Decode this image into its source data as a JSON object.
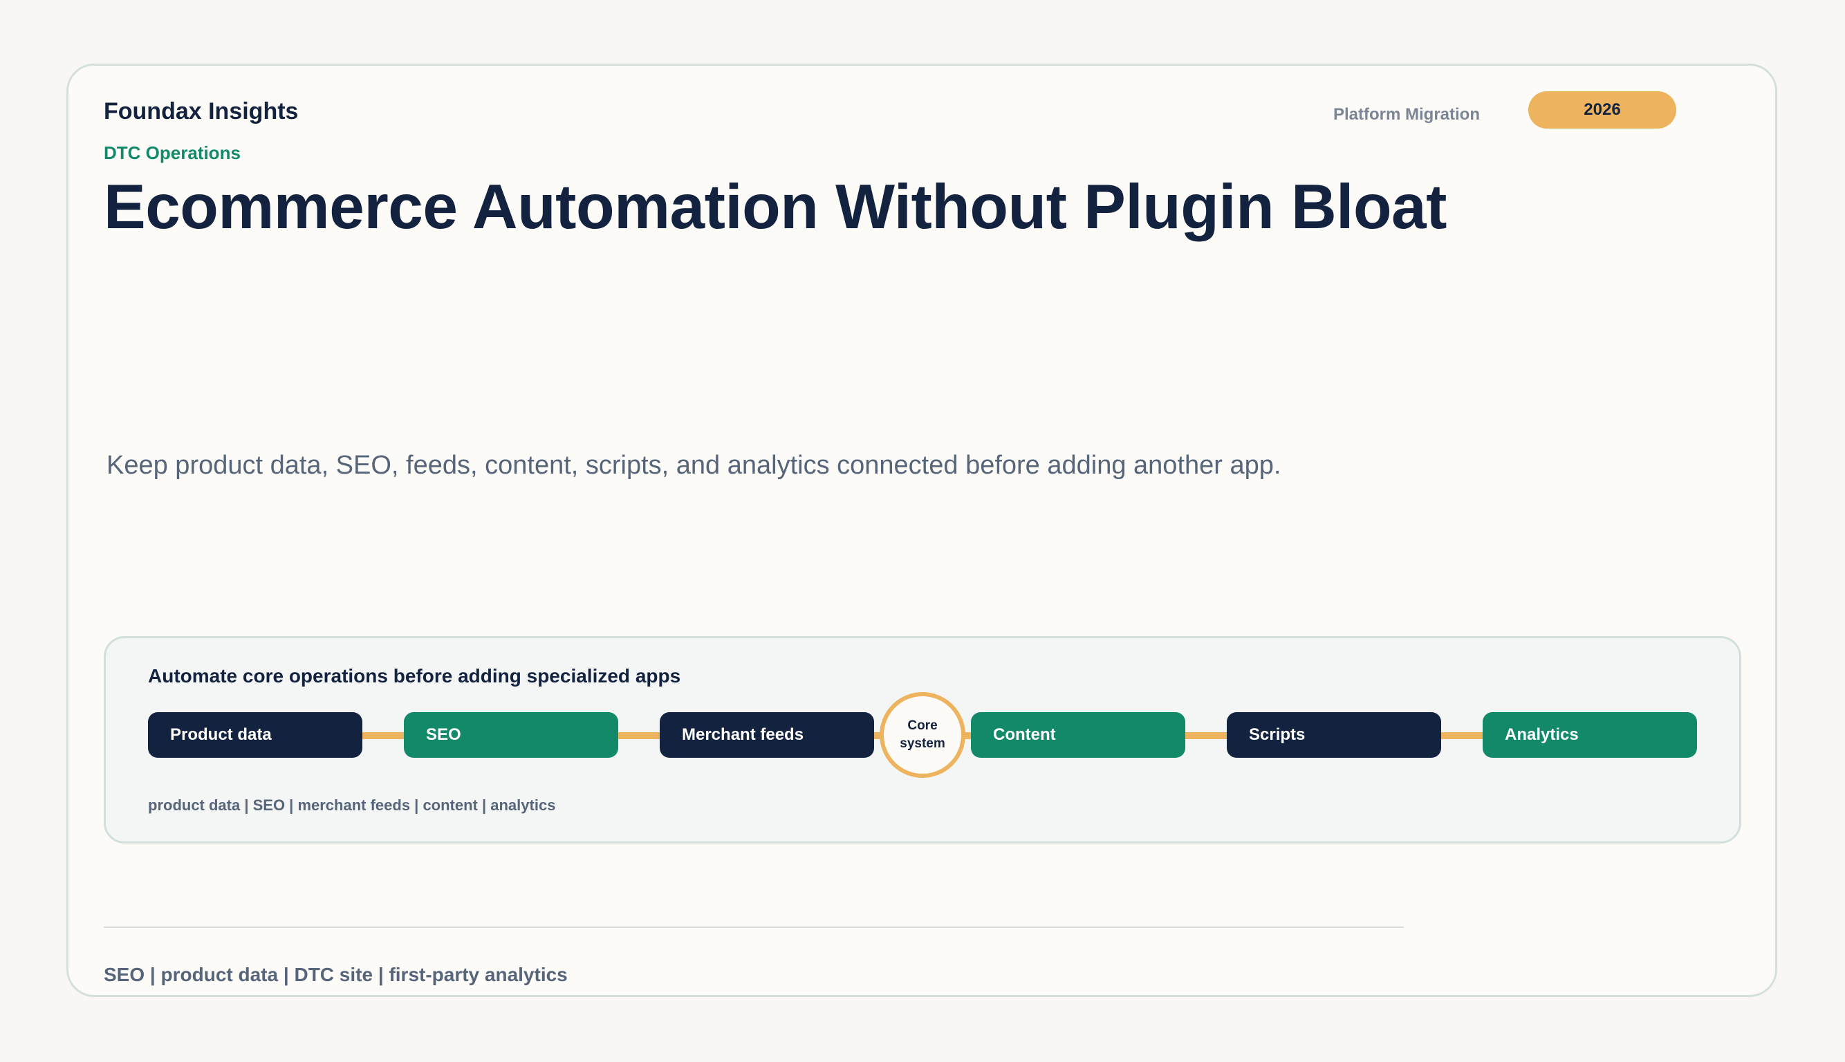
{
  "header": {
    "brand": "Foundax Insights",
    "category": "DTC Operations",
    "title": "Ecommerce Automation Without Plugin Bloat",
    "topic": "Platform Migration",
    "year": "2026"
  },
  "subtitle": "Keep product data, SEO, feeds, content, scripts, and analytics connected before adding another app.",
  "diagram": {
    "heading": "Automate core operations before adding specialized apps",
    "nodes": [
      {
        "label": "Product data",
        "style": "dark"
      },
      {
        "label": "SEO",
        "style": "green"
      },
      {
        "label": "Merchant feeds",
        "style": "dark"
      },
      {
        "label": "Content",
        "style": "green"
      },
      {
        "label": "Scripts",
        "style": "dark"
      },
      {
        "label": "Analytics",
        "style": "green"
      }
    ],
    "core_label": "Core system",
    "tags": "product data | SEO | merchant feeds | content | analytics"
  },
  "footer": {
    "tags": "SEO | product data | DTC site | first-party analytics"
  },
  "colors": {
    "navy": "#13233f",
    "green": "#128a6a",
    "accent": "#eeb35e",
    "muted": "#57657a",
    "background": "#fcfbf7"
  }
}
